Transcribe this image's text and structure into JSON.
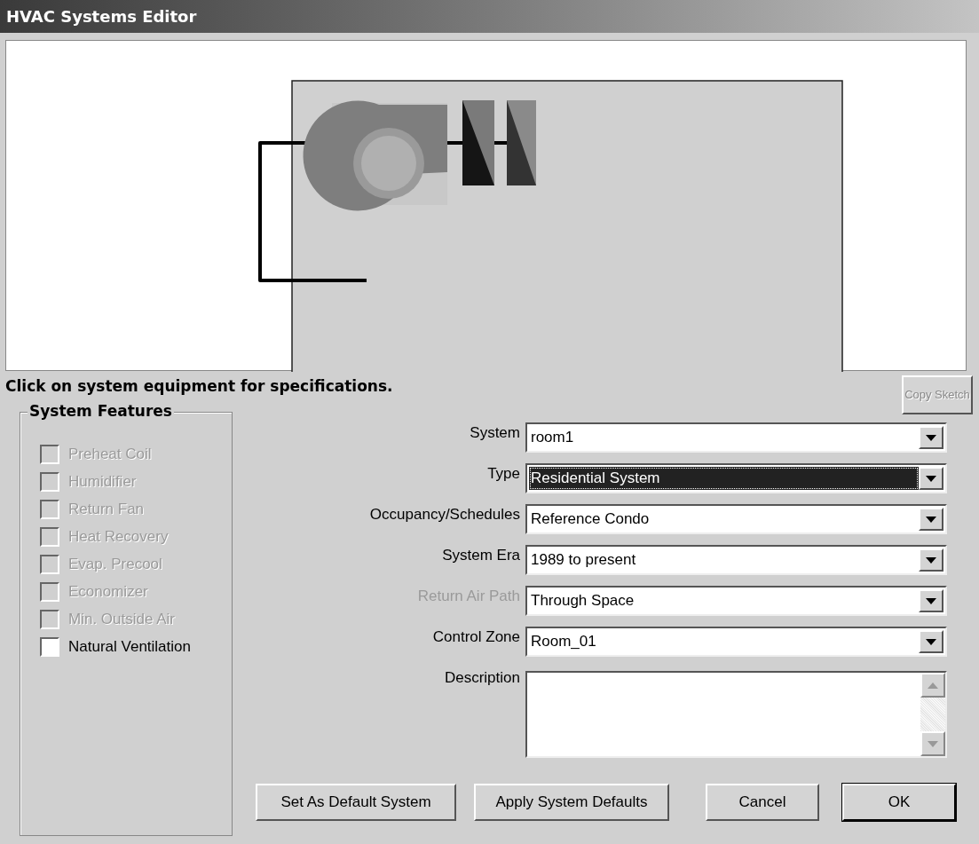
{
  "window": {
    "title": "HVAC Systems Editor"
  },
  "hint": "Click on system equipment for specifications.",
  "copy_button": {
    "label": "Copy Sketch",
    "disabled": true
  },
  "features": {
    "title": "System Features",
    "items": [
      {
        "label": "Preheat Coil",
        "checked": false,
        "disabled": true
      },
      {
        "label": "Humidifier",
        "checked": false,
        "disabled": true
      },
      {
        "label": "Return Fan",
        "checked": false,
        "disabled": true
      },
      {
        "label": "Heat Recovery",
        "checked": false,
        "disabled": true
      },
      {
        "label": "Evap. Precool",
        "checked": false,
        "disabled": true
      },
      {
        "label": "Economizer",
        "checked": false,
        "disabled": true
      },
      {
        "label": "Min. Outside Air",
        "checked": false,
        "disabled": true
      },
      {
        "label": "Natural Ventilation",
        "checked": false,
        "disabled": false
      }
    ]
  },
  "fields": [
    {
      "kind": "combo",
      "label": "System",
      "value": "room1",
      "selected": false,
      "disabled": false
    },
    {
      "kind": "combo",
      "label": "Type",
      "value": "Residential System",
      "selected": true,
      "disabled": false
    },
    {
      "kind": "combo",
      "label": "Occupancy/Schedules",
      "value": "Reference Condo",
      "selected": false,
      "disabled": false
    },
    {
      "kind": "combo",
      "label": "System Era",
      "value": "1989 to present",
      "selected": false,
      "disabled": false
    },
    {
      "kind": "combo",
      "label": "Return Air Path",
      "value": "Through Space",
      "selected": false,
      "disabled": true
    },
    {
      "kind": "combo",
      "label": "Control Zone",
      "value": "Room_01",
      "selected": false,
      "disabled": false
    },
    {
      "kind": "textarea",
      "label": "Description",
      "disabled": false
    }
  ],
  "buttons": [
    {
      "label": "Set As Default System",
      "default": false
    },
    {
      "label": "Apply System Defaults",
      "default": false
    },
    {
      "label": "Cancel",
      "default": false
    },
    {
      "label": "OK",
      "default": true
    }
  ]
}
